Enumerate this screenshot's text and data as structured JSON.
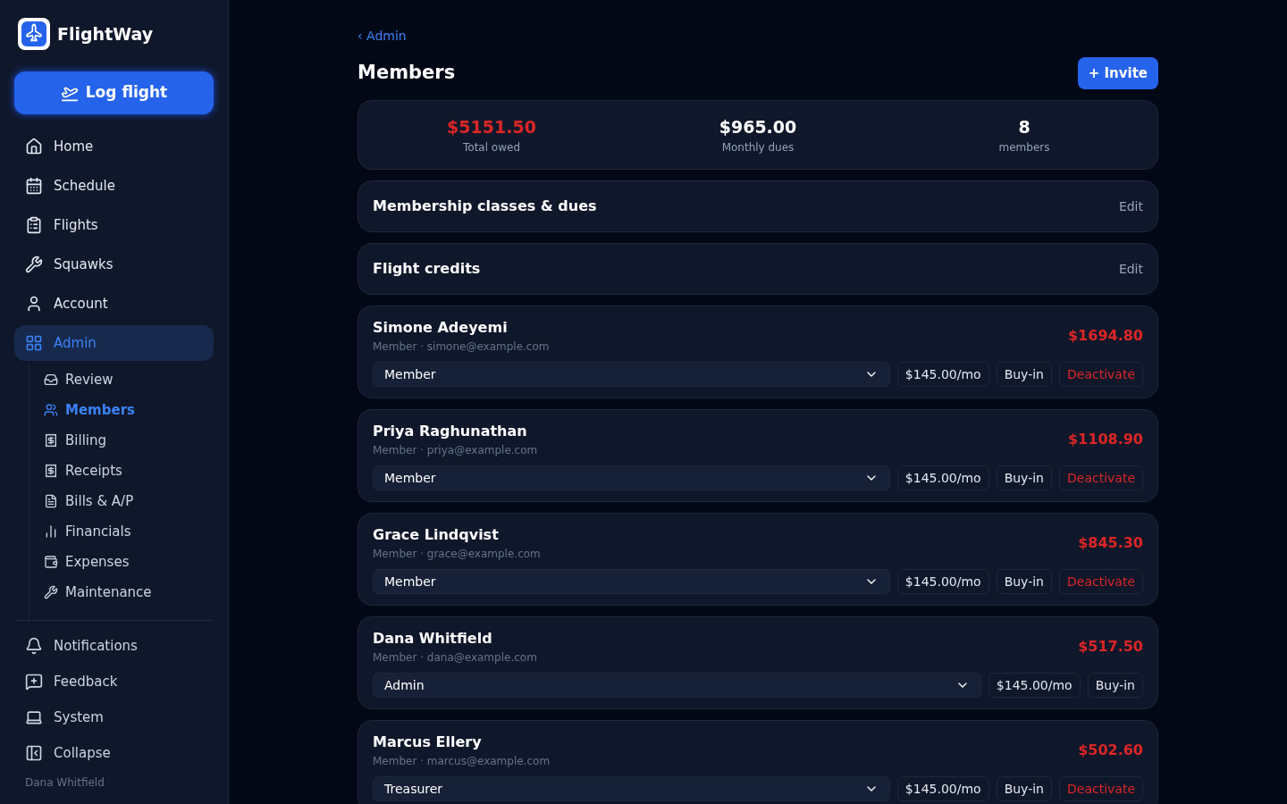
{
  "sidebar": {
    "brand": "FlightWay",
    "log_flight": "Log flight",
    "nav": [
      {
        "label": "Home",
        "selected": false
      },
      {
        "label": "Schedule",
        "selected": false
      },
      {
        "label": "Flights",
        "selected": false
      },
      {
        "label": "Squawks",
        "selected": false
      },
      {
        "label": "Account",
        "selected": false
      },
      {
        "label": "Admin",
        "selected": true
      }
    ],
    "admin_items": [
      {
        "label": "Review",
        "selected": false
      },
      {
        "label": "Members",
        "selected": true
      },
      {
        "label": "Billing",
        "selected": false
      },
      {
        "label": "Receipts",
        "selected": false
      },
      {
        "label": "Bills & A/P",
        "selected": false
      },
      {
        "label": "Financials",
        "selected": false
      },
      {
        "label": "Expenses",
        "selected": false
      },
      {
        "label": "Maintenance",
        "selected": false
      }
    ],
    "bottom": [
      "Notifications",
      "Feedback",
      "System",
      "Collapse"
    ],
    "user": "Dana Whitfield"
  },
  "breadcrumb": "‹ Admin",
  "title": "Members",
  "invite": "+ Invite",
  "stats": [
    {
      "value": "$5151.50",
      "label": "Total owed",
      "alert": true
    },
    {
      "value": "$965.00",
      "label": "Monthly dues",
      "alert": false
    },
    {
      "value": "8",
      "label": "members",
      "alert": false
    }
  ],
  "sections": [
    {
      "title": "Membership classes & dues",
      "action": "Edit"
    },
    {
      "title": "Flight credits",
      "action": "Edit"
    }
  ],
  "members": [
    {
      "name": "Simone Adeyemi",
      "subtitle": "Member · simone@example.com",
      "owed": "$1694.80",
      "role": "Member",
      "dues": "$145.00/mo",
      "buy_in": "Buy-in",
      "deactivate": "Deactivate"
    },
    {
      "name": "Priya Raghunathan",
      "subtitle": "Member · priya@example.com",
      "owed": "$1108.90",
      "role": "Member",
      "dues": "$145.00/mo",
      "buy_in": "Buy-in",
      "deactivate": "Deactivate"
    },
    {
      "name": "Grace Lindqvist",
      "subtitle": "Member · grace@example.com",
      "owed": "$845.30",
      "role": "Member",
      "dues": "$145.00/mo",
      "buy_in": "Buy-in",
      "deactivate": "Deactivate"
    },
    {
      "name": "Dana Whitfield",
      "subtitle": "Member · dana@example.com",
      "owed": "$517.50",
      "role": "Admin",
      "dues": "$145.00/mo",
      "buy_in": "Buy-in"
    },
    {
      "name": "Marcus Ellery",
      "subtitle": "Member · marcus@example.com",
      "owed": "$502.60",
      "role": "Treasurer",
      "dues": "$145.00/mo",
      "buy_in": "Buy-in",
      "deactivate": "Deactivate"
    }
  ]
}
